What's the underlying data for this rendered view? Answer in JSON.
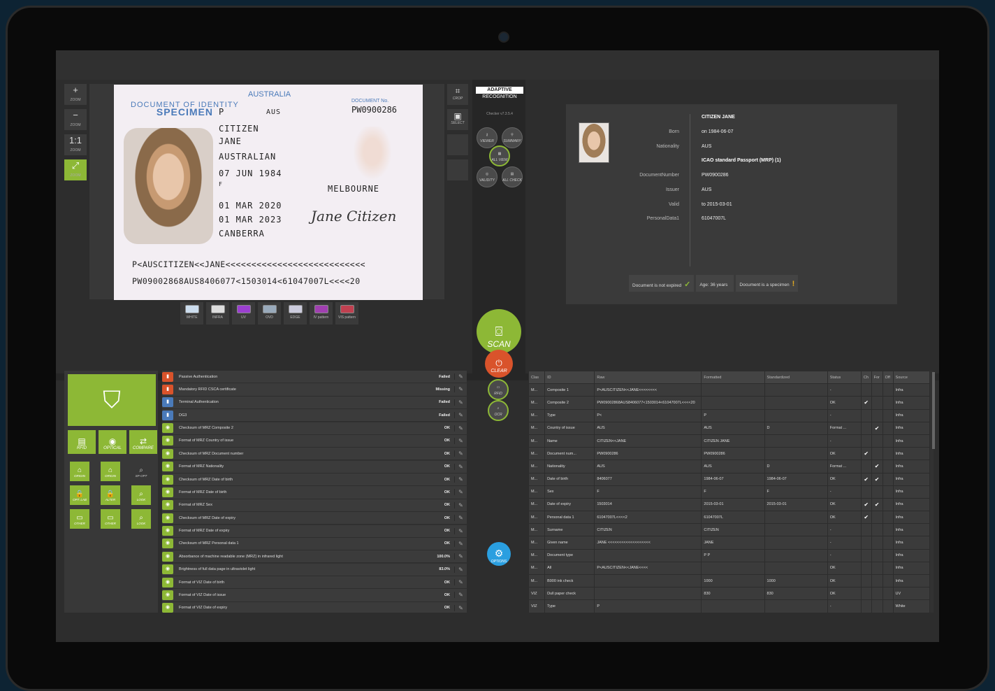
{
  "zoom": [
    {
      "icon": "+",
      "label": "ZOOM"
    },
    {
      "icon": "−",
      "label": "ZOOM"
    },
    {
      "icon": "1:1",
      "label": "ZOOM"
    },
    {
      "icon": "⤢",
      "label": "ZOOM"
    }
  ],
  "document": {
    "country": "AUSTRALIA",
    "specimen_1": "DOCUMENT OF IDENTITY",
    "specimen_2": "SPECIMEN",
    "doc_no_label": "DOCUMENT No.",
    "doc_no": "PW0900286",
    "type": "P",
    "state": "AUS",
    "surname": "CITIZEN",
    "given": "JANE",
    "nationality": "AUSTRALIAN",
    "dob": "07 JUN 1984",
    "sex": "F",
    "pob": "MELBOURNE",
    "issue": "01 MAR 2020",
    "expiry": "01 MAR 2023",
    "authority": "CANBERRA",
    "signature": "Jane Citizen",
    "mrz1": "P<AUSCITIZEN<<JANE<<<<<<<<<<<<<<<<<<<<<<<<<<<",
    "mrz2": "PW09002868AUS8406077<1503014<61047007L<<<<20"
  },
  "lights": [
    "WHITE",
    "INFRA",
    "UV",
    "OVD",
    "EDGE",
    "IV pattern",
    "VIS pattern"
  ],
  "crop": [
    {
      "icon": "⌗",
      "label": "CROP"
    },
    {
      "icon": "▣",
      "label": "SELECT"
    }
  ],
  "brand": {
    "line1": "ADAPTIVE",
    "line2": "RECOGNITION",
    "version": "Checker v7.3.5.4"
  },
  "round_buttons": [
    "VIEWER",
    "SUMMARY",
    "ALL VIEW",
    "VALIDITY",
    "ALL CHECK"
  ],
  "scan": {
    "label": "SCAN"
  },
  "clear": {
    "label": "CLEAR"
  },
  "rfid": "RFID",
  "ocr": "OCR",
  "options": "OPTIONS",
  "person": {
    "name": "CITIZEN JANE",
    "rows": [
      [
        "Born",
        "on 1984-06-07"
      ],
      [
        "Nationality",
        "AUS"
      ],
      [
        "",
        "ICAO standard Passport (MRP) (1)"
      ],
      [
        "DocumentNumber",
        "PW0900286"
      ],
      [
        "Issuer",
        "AUS"
      ],
      [
        "Valid",
        "to 2015-03-01"
      ],
      [
        "PersonalData1",
        "61047007L"
      ]
    ],
    "chips": [
      {
        "text": "Document is not expired",
        "mark": "✓"
      },
      {
        "text": "Age: 36 years",
        "mark": ""
      },
      {
        "text": "Document is a specimen",
        "mark": "!"
      }
    ]
  },
  "modes": [
    {
      "icon": "▤",
      "label": "RFID"
    },
    {
      "icon": "◉",
      "label": "OPTICAL"
    },
    {
      "icon": "⇄",
      "label": "COMPARE"
    }
  ],
  "tools": [
    {
      "icon": "⌂",
      "label": "ORIGIN"
    },
    {
      "icon": "⌂",
      "label": "ORIGIN"
    },
    {
      "icon": "⌕",
      "label": "SP-OPT"
    },
    {
      "icon": "🔒",
      "label": "OPT. LAB"
    },
    {
      "icon": "🔒",
      "label": "ALTER"
    },
    {
      "icon": "⌕",
      "label": "LOOK"
    },
    {
      "icon": "▭",
      "label": "OTHER"
    },
    {
      "icon": "▭",
      "label": "OTHER"
    },
    {
      "icon": "⌕",
      "label": "LOOK"
    }
  ],
  "checks": [
    {
      "c": "#d9532b",
      "t": "Passive Authentication",
      "s": "Failed"
    },
    {
      "c": "#d9532b",
      "t": "Mandatory RFID CSCA certificate",
      "s": "Missing"
    },
    {
      "c": "#4a7ab9",
      "t": "Terminal Authentication",
      "s": "Failed"
    },
    {
      "c": "#4a7ab9",
      "t": "DG3",
      "s": "Failed"
    },
    {
      "c": "#8db836",
      "t": "Checksum of MRZ Composite 2",
      "s": "OK"
    },
    {
      "c": "#8db836",
      "t": "Format of MRZ Country of issue",
      "s": "OK"
    },
    {
      "c": "#8db836",
      "t": "Checksum of MRZ Document number",
      "s": "OK"
    },
    {
      "c": "#8db836",
      "t": "Format of MRZ Nationality",
      "s": "OK"
    },
    {
      "c": "#8db836",
      "t": "Checksum of MRZ Date of birth",
      "s": "OK"
    },
    {
      "c": "#8db836",
      "t": "Format of MRZ Date of birth",
      "s": "OK"
    },
    {
      "c": "#8db836",
      "t": "Format of MRZ Sex",
      "s": "OK"
    },
    {
      "c": "#8db836",
      "t": "Checksum of MRZ Date of expiry",
      "s": "OK"
    },
    {
      "c": "#8db836",
      "t": "Format of MRZ Date of expiry",
      "s": "OK"
    },
    {
      "c": "#8db836",
      "t": "Checksum of MRZ Personal data 1",
      "s": "OK"
    },
    {
      "c": "#8db836",
      "t": "Absorbance of machine readable zone (MRZ) in infrared light",
      "s": "100.0%"
    },
    {
      "c": "#8db836",
      "t": "Brightness of full data page in ultraviolet light",
      "s": "83.0%"
    },
    {
      "c": "#8db836",
      "t": "Format of VIZ Date of birth",
      "s": "OK"
    },
    {
      "c": "#8db836",
      "t": "Format of VIZ Date of issue",
      "s": "OK"
    },
    {
      "c": "#8db836",
      "t": "Format of VIZ Date of expiry",
      "s": "OK"
    }
  ],
  "table": {
    "headers": [
      "Clas",
      "ID",
      "Raw",
      "Formatted",
      "Standardized",
      "Status",
      "Ch",
      "For",
      "Off",
      "Source"
    ],
    "rows": [
      [
        "M...",
        "Composite 1",
        "P<AUSCITIZEN<<JANE<<<<<<<<",
        "",
        "",
        "-",
        "",
        "",
        "",
        "Infra"
      ],
      [
        "M...",
        "Composite 2",
        "PW09002868AUS8406077<1503014<61047007L<<<<20",
        "",
        "",
        "OK",
        "✔",
        "",
        "",
        "Infra"
      ],
      [
        "M...",
        "Type",
        "P<",
        "P",
        "",
        "-",
        "",
        "",
        "",
        "Infra"
      ],
      [
        "M...",
        "Country of issue",
        "AUS",
        "AUS",
        "D",
        "Format ...",
        "",
        "✔",
        "",
        "Infra"
      ],
      [
        "M...",
        "Name",
        "CITIZEN<<JANE",
        "CITIZEN JANE",
        "",
        "-",
        "",
        "",
        "",
        "Infra"
      ],
      [
        "M...",
        "Document num...",
        "PW0900286",
        "PW0900286",
        "",
        "OK",
        "✔",
        "",
        "",
        "Infra"
      ],
      [
        "M...",
        "Nationality",
        "AUS",
        "AUS",
        "D",
        "Format ...",
        "",
        "✔",
        "",
        "Infra"
      ],
      [
        "M...",
        "Date of birth",
        "8406077",
        "1984-06-07",
        "1984-06-07",
        "OK",
        "✔",
        "✔",
        "",
        "Infra"
      ],
      [
        "M...",
        "Sex",
        "F",
        "F",
        "F",
        "-",
        "",
        "",
        "",
        "Infra"
      ],
      [
        "M...",
        "Date of expiry",
        "1503014",
        "2015-03-01",
        "2015-03-01",
        "OK",
        "✔",
        "✔",
        "",
        "Infra"
      ],
      [
        "M...",
        "Personal data 1",
        "61047007L<<<<2",
        "61047007L",
        "",
        "OK",
        "✔",
        "",
        "",
        "Infra"
      ],
      [
        "M...",
        "Surname",
        "CITIZEN",
        "CITIZEN",
        "",
        "-",
        "",
        "",
        "",
        "Infra"
      ],
      [
        "M...",
        "Given name",
        "JANE <<<<<<<<<<<<<<<<<<<",
        "JANE",
        "",
        "-",
        "",
        "",
        "",
        "Infra"
      ],
      [
        "M...",
        "Document type",
        "",
        "P P",
        "",
        "-",
        "",
        "",
        "",
        "Infra"
      ],
      [
        "M...",
        "All",
        "P<AUSCITIZEN<<JANE<<<<",
        "",
        "",
        "OK",
        "",
        "",
        "",
        "Infra"
      ],
      [
        "M...",
        "B900 ink check",
        "",
        "1000",
        "1000",
        "OK",
        "",
        "",
        "",
        "Infra"
      ],
      [
        "VIZ",
        "Dull paper check",
        "",
        "830",
        "830",
        "OK",
        "",
        "",
        "",
        "UV"
      ],
      [
        "VIZ",
        "Type",
        "P",
        "",
        "",
        "-",
        "",
        "",
        "",
        "White"
      ]
    ]
  }
}
